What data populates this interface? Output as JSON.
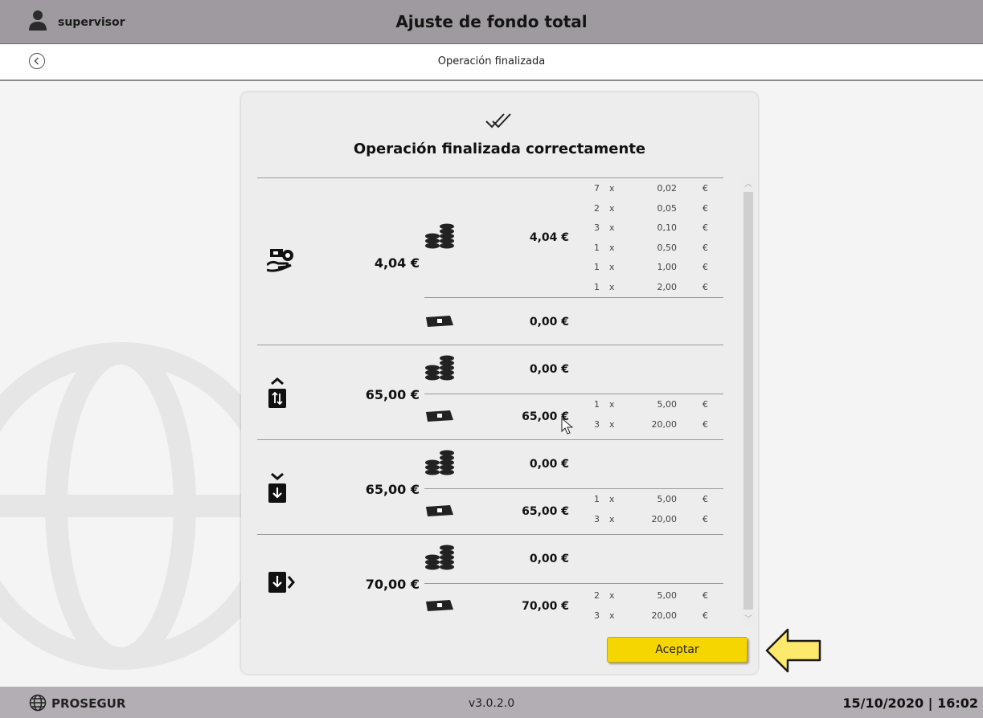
{
  "header": {
    "user": "supervisor",
    "title": "Ajuste de fondo total"
  },
  "subheader": {
    "title": "Operación finalizada"
  },
  "card": {
    "title": "Operación finalizada correctamente",
    "accept_label": "Aceptar"
  },
  "sections": [
    {
      "icon": "cash-in-hand-icon",
      "total": "4,04 €",
      "coins": {
        "total": "4,04 €",
        "rows": [
          {
            "qty": "7",
            "x": "x",
            "value": "0,02",
            "cur": "€"
          },
          {
            "qty": "2",
            "x": "x",
            "value": "0,05",
            "cur": "€"
          },
          {
            "qty": "3",
            "x": "x",
            "value": "0,10",
            "cur": "€"
          },
          {
            "qty": "1",
            "x": "x",
            "value": "0,50",
            "cur": "€"
          },
          {
            "qty": "1",
            "x": "x",
            "value": "1,00",
            "cur": "€"
          },
          {
            "qty": "1",
            "x": "x",
            "value": "2,00",
            "cur": "€"
          }
        ]
      },
      "notes": {
        "total": "0,00 €",
        "rows": []
      }
    },
    {
      "icon": "cassette-exchange-icon",
      "total": "65,00 €",
      "coins": {
        "total": "0,00 €",
        "rows": []
      },
      "notes": {
        "total": "65,00 €",
        "rows": [
          {
            "qty": "1",
            "x": "x",
            "value": "5,00",
            "cur": "€"
          },
          {
            "qty": "3",
            "x": "x",
            "value": "20,00",
            "cur": "€"
          }
        ]
      }
    },
    {
      "icon": "cassette-down-icon",
      "total": "65,00 €",
      "coins": {
        "total": "0,00 €",
        "rows": []
      },
      "notes": {
        "total": "65,00 €",
        "rows": [
          {
            "qty": "1",
            "x": "x",
            "value": "5,00",
            "cur": "€"
          },
          {
            "qty": "3",
            "x": "x",
            "value": "20,00",
            "cur": "€"
          }
        ]
      }
    },
    {
      "icon": "cassette-out-icon",
      "total": "70,00 €",
      "coins": {
        "total": "0,00 €",
        "rows": []
      },
      "notes": {
        "total": "70,00 €",
        "rows": [
          {
            "qty": "2",
            "x": "x",
            "value": "5,00",
            "cur": "€"
          },
          {
            "qty": "3",
            "x": "x",
            "value": "20,00",
            "cur": "€"
          }
        ]
      }
    }
  ],
  "footer": {
    "brand": "PROSEGUR",
    "version": "v3.0.2.0",
    "datetime": "15/10/2020 | 16:02"
  },
  "colors": {
    "topbar": "#9e9a9f",
    "footer": "#b3aeb3",
    "accent": "#f6d600",
    "card": "#ededed"
  }
}
